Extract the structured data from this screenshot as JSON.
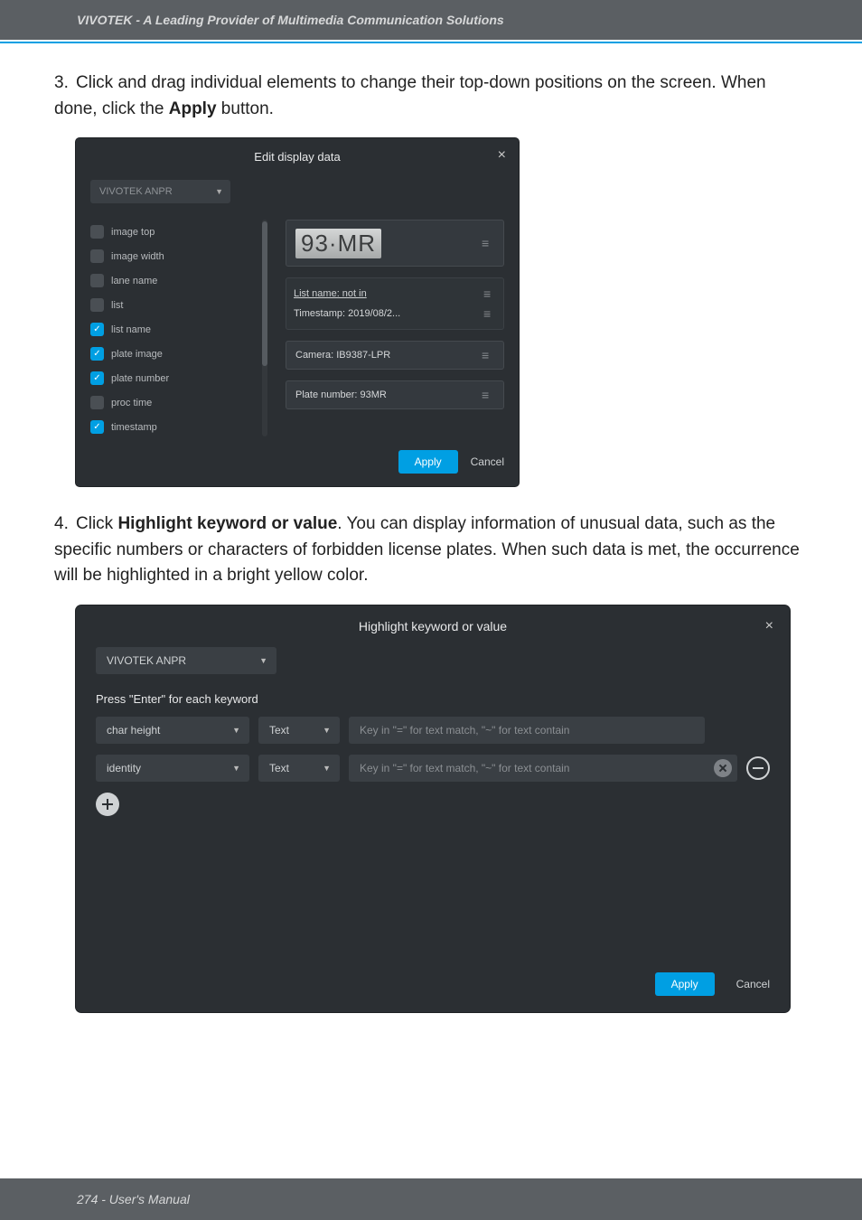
{
  "header": {
    "brand_line": "VIVOTEK - A Leading Provider of Multimedia Communication Solutions"
  },
  "step3": {
    "num": "3.",
    "text_1": "Click and drag individual elements to change their top-down positions on the screen. When done, click the ",
    "bold": "Apply",
    "text_2": " button."
  },
  "dialog1": {
    "title": "Edit display data",
    "select_value": "VIVOTEK ANPR",
    "left_items": [
      {
        "label": "image top",
        "checked": false
      },
      {
        "label": "image width",
        "checked": false
      },
      {
        "label": "lane name",
        "checked": false
      },
      {
        "label": "list",
        "checked": false
      },
      {
        "label": "list name",
        "checked": true
      },
      {
        "label": "plate image",
        "checked": true
      },
      {
        "label": "plate number",
        "checked": true
      },
      {
        "label": "proc time",
        "checked": false
      },
      {
        "label": "timestamp",
        "checked": true
      }
    ],
    "preview": {
      "plate_image_text": "93·MR",
      "listname_label": "List name: not in",
      "timestamp_label": "Timestamp: 2019/08/2...",
      "camera_label": "Camera: IB9387-LPR",
      "platenum_label": "Plate number: 93MR"
    },
    "buttons": {
      "apply": "Apply",
      "cancel": "Cancel"
    }
  },
  "step4": {
    "num": "4.",
    "text_1": "Click ",
    "bold": "Highlight keyword or value",
    "text_2": ". You can display information of unusual data, such as the specific numbers or characters of forbidden license plates. When such data is met, the occurrence will be highlighted in a bright yellow color."
  },
  "dialog2": {
    "title": "Highlight keyword or value",
    "select_value": "VIVOTEK ANPR",
    "subtitle": "Press \"Enter\" for each keyword",
    "rows": [
      {
        "field": "char height",
        "type": "Text",
        "placeholder": "Key in \"=\" for text match, \"~\" for text contain",
        "has_clear": false,
        "has_remove": false
      },
      {
        "field": "identity",
        "type": "Text",
        "placeholder": "Key in \"=\" for text match, \"~\" for text contain",
        "has_clear": true,
        "has_remove": true
      }
    ],
    "buttons": {
      "apply": "Apply",
      "cancel": "Cancel"
    }
  },
  "footer": {
    "text": "274 - User's Manual"
  }
}
